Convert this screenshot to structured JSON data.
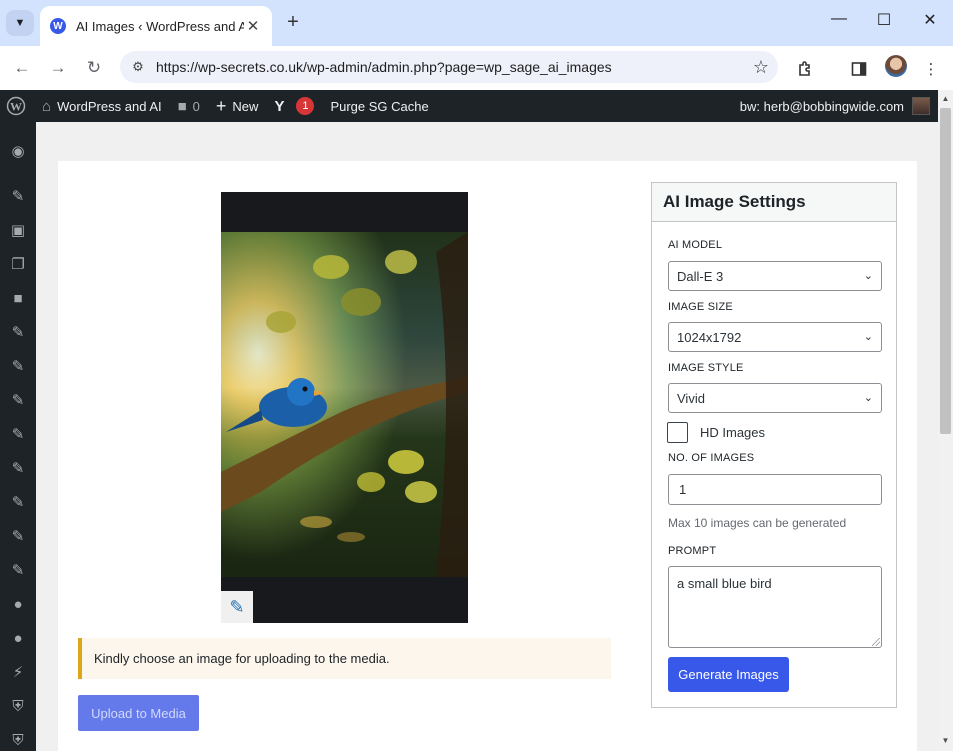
{
  "browser": {
    "tab_title": "AI Images ‹ WordPress and AI —",
    "url": "https://wp-secrets.co.uk/wp-admin/admin.php?page=wp_sage_ai_images"
  },
  "adminbar": {
    "site_name": "WordPress and AI",
    "comments_count": "0",
    "new_label": "New",
    "yoast_count": "1",
    "purge_label": "Purge SG Cache",
    "user_label": "bw: herb@bobbingwide.com"
  },
  "sidebar": {
    "icons": [
      "dashboard-icon",
      "pin-icon",
      "media-icon",
      "pages-icon",
      "comments-icon",
      "pin-icon",
      "pin-icon",
      "pin-icon",
      "pin-icon",
      "pin-icon",
      "pin-icon",
      "pin-icon",
      "pin-icon",
      "lightbulb-icon",
      "lightbulb-icon",
      "plugins-icon",
      "shield-icon"
    ]
  },
  "main": {
    "notice": "Kindly choose an image for uploading to the media.",
    "upload_button": "Upload to Media"
  },
  "settings": {
    "title": "AI Image Settings",
    "model_label": "AI MODEL",
    "model_value": "Dall-E 3",
    "size_label": "IMAGE SIZE",
    "size_value": "1024x1792",
    "style_label": "IMAGE STYLE",
    "style_value": "Vivid",
    "hd_label": "HD Images",
    "hd_checked": false,
    "count_label": "NO. OF IMAGES",
    "count_value": "1",
    "count_hint": "Max 10 images can be generated",
    "prompt_label": "PROMPT",
    "prompt_value": "a small blue bird",
    "generate_button": "Generate Images"
  },
  "colors": {
    "wp_dark": "#1d2327",
    "wp_blue": "#3858e9",
    "notice_border": "#dba617"
  }
}
